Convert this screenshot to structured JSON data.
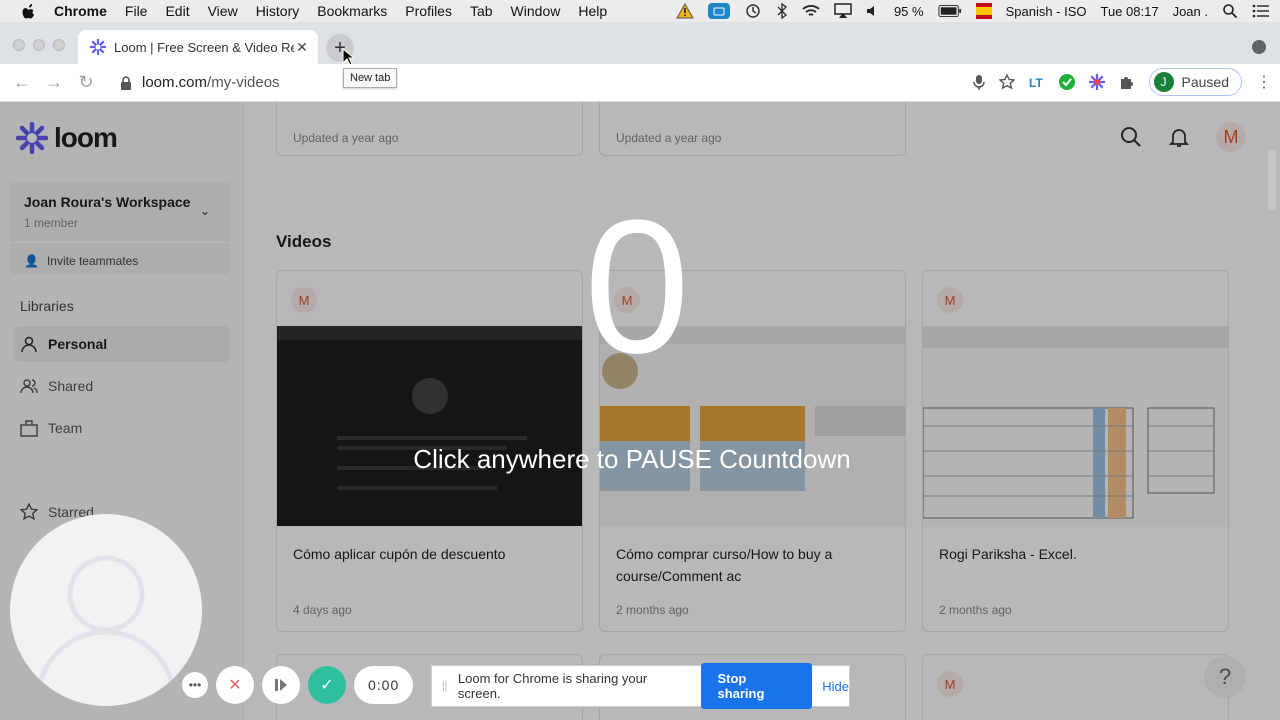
{
  "menubar": {
    "app": "Chrome",
    "items": [
      "File",
      "Edit",
      "View",
      "History",
      "Bookmarks",
      "Profiles",
      "Tab",
      "Window",
      "Help"
    ],
    "battery": "95 %",
    "input_source": "Spanish - ISO",
    "clock": "Tue 08:17",
    "user": "Joan ."
  },
  "browser": {
    "tab_title": "Loom | Free Screen & Video Re",
    "tooltip": "New tab",
    "url_host": "loom.com",
    "url_path": "/my-videos",
    "profile_initial": "J",
    "profile_status": "Paused"
  },
  "sidebar": {
    "brand": "loom",
    "workspace_name": "Joan Roura's Workspace",
    "workspace_members": "1 member",
    "invite": "Invite teammates",
    "libraries_heading": "Libraries",
    "items": [
      {
        "label": "Personal",
        "icon": "person-icon"
      },
      {
        "label": "Shared",
        "icon": "people-icon"
      },
      {
        "label": "Team",
        "icon": "team-icon"
      },
      {
        "label": "Starred",
        "icon": "star-icon"
      }
    ]
  },
  "main": {
    "avatar_initial": "M",
    "updated_labels": [
      "Updated a year ago",
      "Updated a year ago"
    ],
    "videos_heading": "Videos",
    "videos": [
      {
        "owner": "M",
        "title": "Cómo aplicar cupón de descuento",
        "date": "4 days ago"
      },
      {
        "owner": "M",
        "title": "Cómo comprar curso/How to buy a course/Comment ac",
        "date": "2 months ago"
      },
      {
        "owner": "M",
        "title": "Rogi Pariksha - Excel.",
        "date": "2 months ago"
      }
    ],
    "row2_owner": "M"
  },
  "recording": {
    "countdown": "0",
    "pause_message": "Click anywhere to PAUSE Countdown",
    "timer": "0:00",
    "share_text": "Loom for Chrome is sharing your screen.",
    "stop_label": "Stop sharing",
    "hide_label": "Hide"
  },
  "help_label": "?",
  "colors": {
    "accent": "#1a73e8",
    "loom_brand": "#625df5",
    "confirm": "#2fbf9f"
  }
}
